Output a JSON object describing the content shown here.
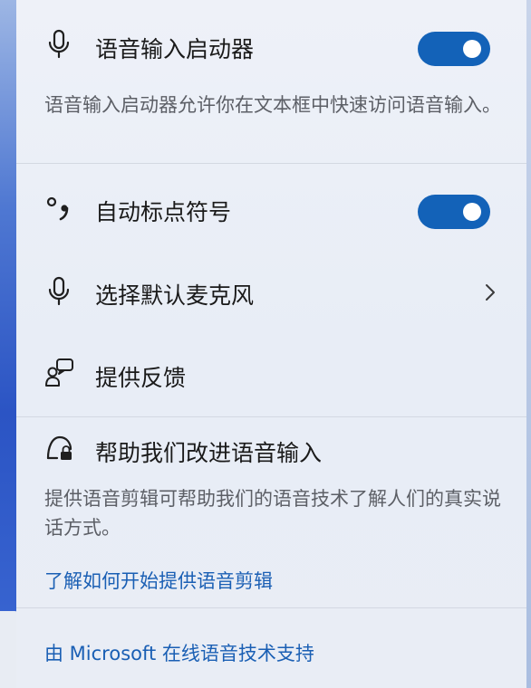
{
  "voice_launcher": {
    "icon": "microphone-icon",
    "label": "语音输入启动器",
    "toggle_on": true,
    "description": "语音输入启动器允许你在文本框中快速访问语音输入。"
  },
  "auto_punctuation": {
    "icon": "punctuation-icon",
    "label": "自动标点符号",
    "toggle_on": true
  },
  "choose_mic": {
    "icon": "microphone-icon",
    "label": "选择默认麦克风",
    "trailing_icon": "chevron-right-icon"
  },
  "feedback": {
    "icon": "feedback-icon",
    "label": "提供反馈"
  },
  "improve": {
    "icon": "privacy-lock-icon",
    "label": "帮助我们改进语音输入",
    "description": "提供语音剪辑可帮助我们的语音技术了解人们的真实说话方式。",
    "link": "了解如何开始提供语音剪辑"
  },
  "footer": {
    "link": "由 Microsoft 在线语音技术支持"
  },
  "colors": {
    "accent": "#1362b8",
    "link": "#1a5fb4",
    "panel_bg": "#eaeef6"
  }
}
